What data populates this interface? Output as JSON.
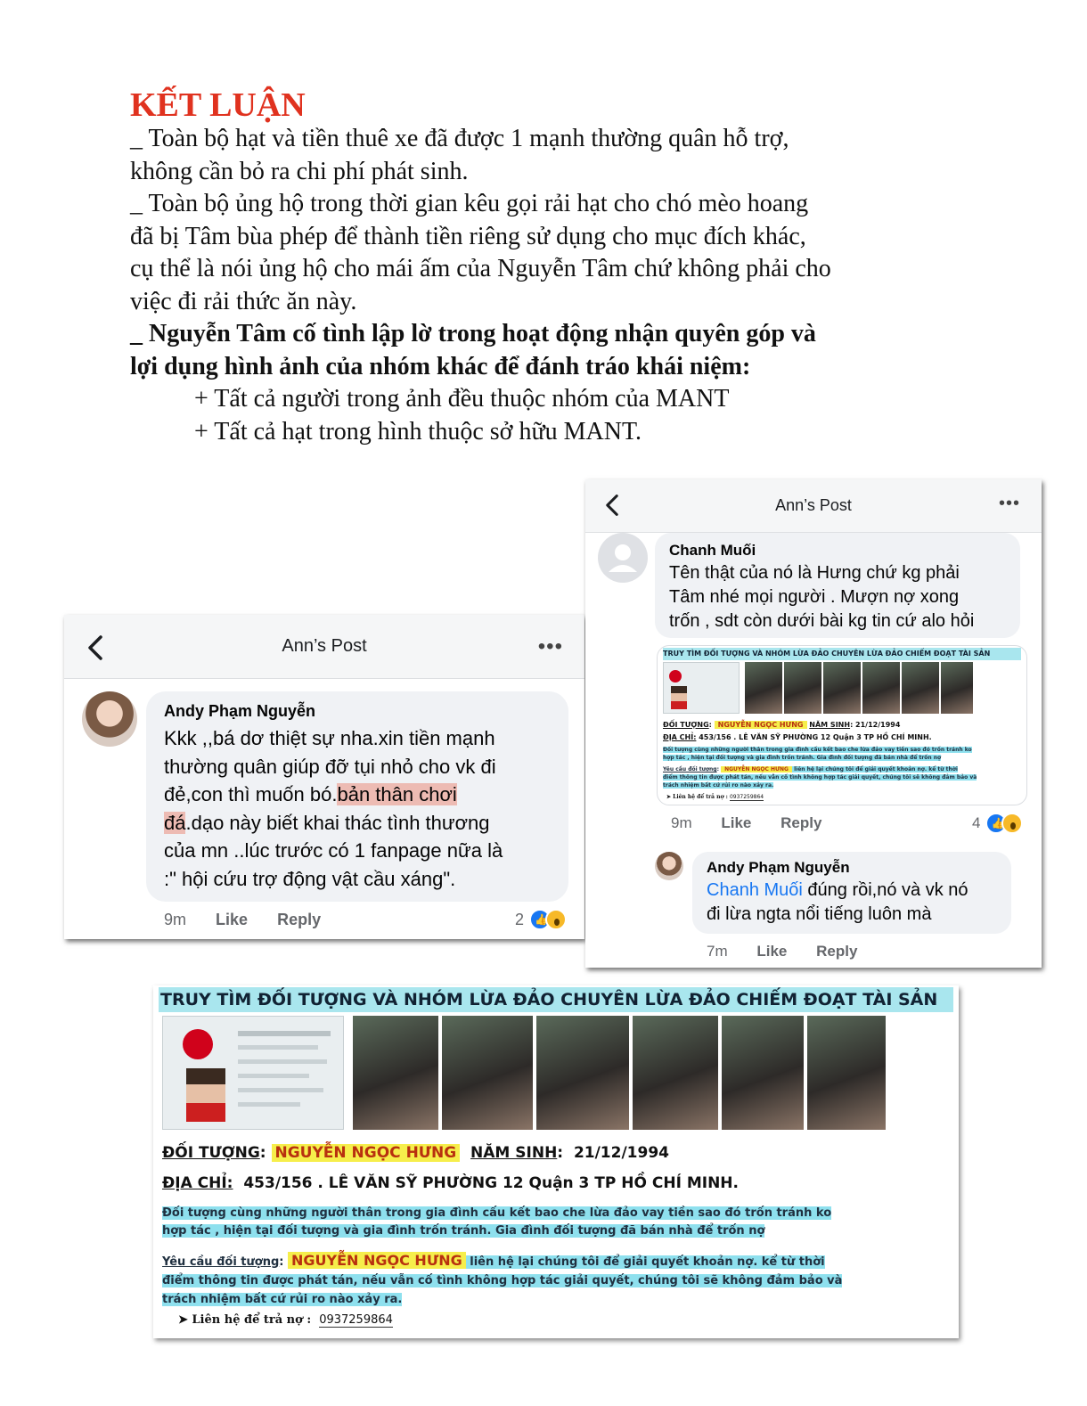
{
  "document": {
    "title": "KẾT LUẬN",
    "lines": [
      "_ Toàn bộ hạt và tiền thuê xe đã được 1 mạnh thường quân hỗ trợ,",
      "không cần bỏ ra chi phí phát sinh.",
      "_ Toàn bộ ủng hộ trong thời gian kêu gọi rải hạt cho chó mèo hoang",
      "đã bị Tâm bùa phép để thành tiền riêng sử dụng cho mục đích khác,",
      "cụ thể là nói ủng hộ cho mái ấm của Nguyễn Tâm chứ không phải cho",
      "việc đi rải thức ăn này."
    ],
    "bold_lines": [
      "_ Nguyễn Tâm cố tình lập lờ trong hoạt động nhận quyên góp và",
      "lợi dụng hình ảnh của nhóm khác để đánh tráo khái niệm:"
    ],
    "sub_lines": [
      "+ Tất cả người trong ảnh đều thuộc nhóm của MANT",
      "+ Tất cả hạt trong hình thuộc sở hữu MANT."
    ]
  },
  "left_post": {
    "header_title": "Ann’s Post",
    "more_label": "•••",
    "comment": {
      "author": "Andy Phạm Nguyễn",
      "text_lines": [
        "Kkk ,,bá dơ thiệt sự nha.xin tiền mạnh",
        "thường quân giúp đỡ tụi nhỏ cho vk đi"
      ],
      "line3_pre": "đẻ,con thì muốn bó.",
      "line3_hl": "bản thân chơi",
      "line4_hl": "đá",
      "line4_post": ".dạo này biết khai thác tình thương",
      "text_lines_end": [
        "của mn ..lúc trước có 1 fanpage nữa là",
        ":\" hội cứu trợ động vật cầu xáng\"."
      ],
      "time": "9m",
      "like": "Like",
      "reply": "Reply",
      "reactions": "2"
    }
  },
  "right_post": {
    "header_title": "Ann’s Post",
    "more_label": "•••",
    "comment": {
      "author": "Chanh Muối",
      "text_lines": [
        "Tên thật của nó là Hưng chứ kg phải",
        "Tâm nhé mọi người . Mượn nợ xong",
        "trốn , sdt còn dưới bài kg tin cứ alo hỏi"
      ],
      "time": "9m",
      "like": "Like",
      "reply": "Reply",
      "reactions": "4"
    },
    "reply": {
      "author": "Andy Phạm Nguyễn",
      "mention": "Chanh Muối",
      "text_rest": " đúng rồi,nó và vk nó",
      "text_line2": "đi lừa ngta nổi tiếng luôn mà",
      "time": "7m",
      "like": "Like",
      "reply": "Reply"
    }
  },
  "poster": {
    "banner": "TRUY TÌM ĐỐI TƯỢNG VÀ NHÓM LỪA ĐẢO CHUYÊN LỪA ĐẢO CHIẾM ĐOẠT TÀI SẢN",
    "subject_label": "ĐỐI TƯỢNG",
    "subject_name": "NGUYỄN NGỌC HƯNG",
    "dob_label": "NĂM SINH",
    "dob_value": "21/12/1994",
    "address_label": "ĐỊA CHỈ:",
    "address_value": "453/156 . LÊ VĂN SỸ PHƯỜNG 12 Quận 3 TP HỒ CHÍ MINH.",
    "para1_line1": "Đối tượng cùng những người thân trong gia đình cấu kết bao che lừa đảo vay tiền sao đó trốn tránh ko",
    "para1_line2": "hợp tác , hiện tại đối tượng và gia đình trốn tránh. Gia đình đối tượng đã bán nhà để trốn nợ",
    "request_label": "Yêu cầu đối tượng",
    "request_name": "NGUYỄN NGỌC HƯNG",
    "request_line1": " liên hệ lại chúng tôi để giải quyết khoản nợ. kể từ thời",
    "request_line2": "điểm thông tin được phát tán, nếu vẫn cố tình không hợp tác giải quyết, chúng tôi sẽ không đảm bảo và",
    "request_line3": "trách nhiệm bất cứ rủi ro nào xảy ra.",
    "contact_label": "➤ Liên hệ để trả nợ :",
    "contact_value": "0937259864"
  }
}
